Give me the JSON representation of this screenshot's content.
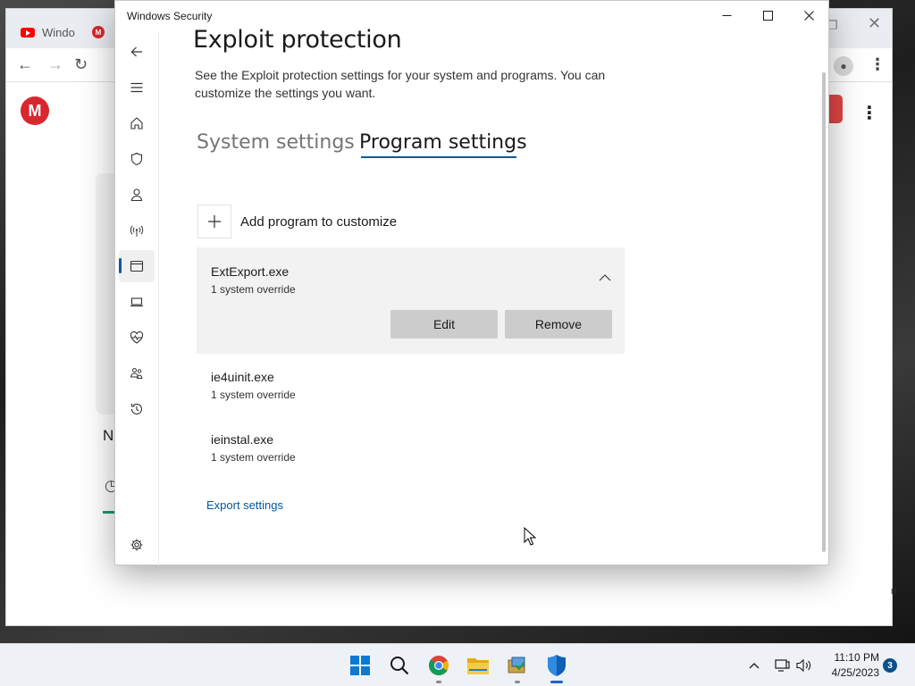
{
  "browser": {
    "tabs": [
      {
        "label": "Windo",
        "icon": "youtube-icon"
      },
      {
        "label": "",
        "icon": "mega-icon"
      }
    ],
    "page_logo": "M",
    "card_text": "N"
  },
  "window": {
    "title": "Windows Security"
  },
  "nav": {
    "items": [
      {
        "name": "back-icon"
      },
      {
        "name": "menu-icon"
      },
      {
        "name": "home-icon"
      },
      {
        "name": "shield-icon"
      },
      {
        "name": "person-icon"
      },
      {
        "name": "wifi-antenna-icon"
      },
      {
        "name": "app-browser-icon",
        "active": true
      },
      {
        "name": "laptop-icon"
      },
      {
        "name": "health-heart-icon"
      },
      {
        "name": "family-icon"
      },
      {
        "name": "history-icon"
      },
      {
        "name": "settings-gear-icon"
      }
    ]
  },
  "main": {
    "title": "Exploit protection",
    "description": "See the Exploit protection settings for your system and programs.  You can customize the settings you want.",
    "tabs": [
      {
        "label": "System settings",
        "selected": false
      },
      {
        "label": "Program settings",
        "selected": true
      }
    ],
    "add_program_label": "Add program to customize",
    "programs": [
      {
        "name": "ExtExport.exe",
        "subtitle": "1 system override",
        "expanded": true
      },
      {
        "name": "ie4uinit.exe",
        "subtitle": "1 system override",
        "expanded": false
      },
      {
        "name": "ieinstal.exe",
        "subtitle": "1 system override",
        "expanded": false
      }
    ],
    "edit_label": "Edit",
    "remove_label": "Remove",
    "export_label": "Export settings"
  },
  "taskbar": {
    "apps": [
      "windows-start-icon",
      "search-icon",
      "chrome-icon",
      "file-explorer-icon",
      "app-installer-icon",
      "windows-security-icon"
    ],
    "time": "11:10 PM",
    "date": "4/25/2023",
    "notification_count": "3"
  },
  "colors": {
    "accent": "#005a9e",
    "expanded_bg": "#f2f2f2",
    "button_bg": "#cccccc"
  }
}
